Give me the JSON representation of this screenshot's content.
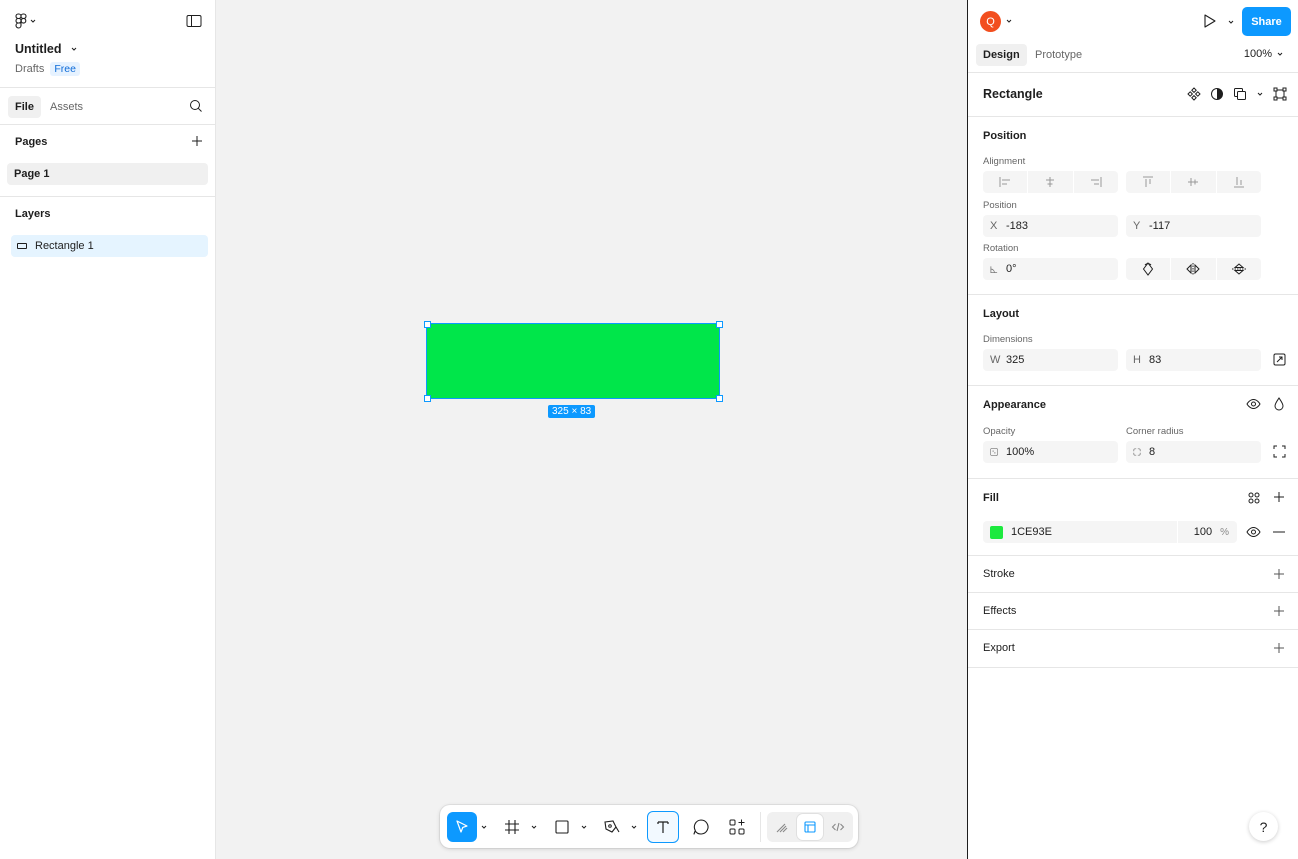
{
  "file": {
    "title": "Untitled",
    "location": "Drafts",
    "plan_badge": "Free"
  },
  "left_tabs": {
    "file": "File",
    "assets": "Assets"
  },
  "pages": {
    "heading": "Pages",
    "items": [
      "Page 1"
    ]
  },
  "layers": {
    "heading": "Layers",
    "items": [
      "Rectangle 1"
    ]
  },
  "canvas": {
    "selection_size": "325 × 83",
    "rect_fill": "#00E64A",
    "selection_color": "#0D99FF"
  },
  "toolbar": {
    "tools": [
      "move-tool",
      "frame-tool",
      "rectangle-tool",
      "pen-tool",
      "text-tool",
      "comment-tool",
      "actions-tool"
    ],
    "modes": [
      "draw-mode",
      "design-mode",
      "dev-mode"
    ]
  },
  "right": {
    "avatar_initial": "Q",
    "share_label": "Share",
    "tabs": {
      "design": "Design",
      "prototype": "Prototype"
    },
    "zoom": "100%",
    "object_name": "Rectangle",
    "position": {
      "heading": "Position",
      "alignment_label": "Alignment",
      "position_label": "Position",
      "x_prefix": "X",
      "x": "-183",
      "y_prefix": "Y",
      "y": "-117",
      "rotation_label": "Rotation",
      "rotation": "0°"
    },
    "layout": {
      "heading": "Layout",
      "dimensions_label": "Dimensions",
      "w_prefix": "W",
      "w": "325",
      "h_prefix": "H",
      "h": "83"
    },
    "appearance": {
      "heading": "Appearance",
      "opacity_label": "Opacity",
      "opacity": "100%",
      "corner_label": "Corner radius",
      "corner": "8"
    },
    "fill": {
      "heading": "Fill",
      "hex": "1CE93E",
      "swatch": "#1CE93E",
      "opacity": "100",
      "unit": "%"
    },
    "stroke": "Stroke",
    "effects": "Effects",
    "export": "Export",
    "help": "?"
  }
}
